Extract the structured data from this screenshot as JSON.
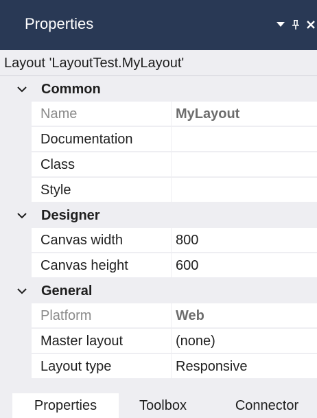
{
  "panel": {
    "title": "Properties",
    "icons": [
      "dropdown-icon",
      "pin-icon",
      "close-icon"
    ]
  },
  "subject": "Layout 'LayoutTest.MyLayout'",
  "categories": [
    {
      "label": "Common",
      "rows": [
        {
          "name": "Name",
          "value": "MyLayout"
        },
        {
          "name": "Documentation",
          "value": ""
        },
        {
          "name": "Class",
          "value": ""
        },
        {
          "name": "Style",
          "value": ""
        }
      ]
    },
    {
      "label": "Designer",
      "rows": [
        {
          "name": "Canvas width",
          "value": "800"
        },
        {
          "name": "Canvas height",
          "value": "600"
        }
      ]
    },
    {
      "label": "General",
      "rows": [
        {
          "name": "Platform",
          "value": "Web"
        },
        {
          "name": "Master layout",
          "value": "(none)"
        },
        {
          "name": "Layout type",
          "value": "Responsive"
        }
      ]
    }
  ],
  "tabs": [
    {
      "label": "Properties",
      "active": true
    },
    {
      "label": "Toolbox",
      "active": false
    },
    {
      "label": "Connector",
      "active": false
    }
  ],
  "colors": {
    "titlebar_bg": "#293955",
    "panel_bg": "#eeeef2",
    "cell_bg": "#ffffff",
    "readonly_name": "#8a8a8a",
    "readonly_value": "#6d6d6d"
  }
}
